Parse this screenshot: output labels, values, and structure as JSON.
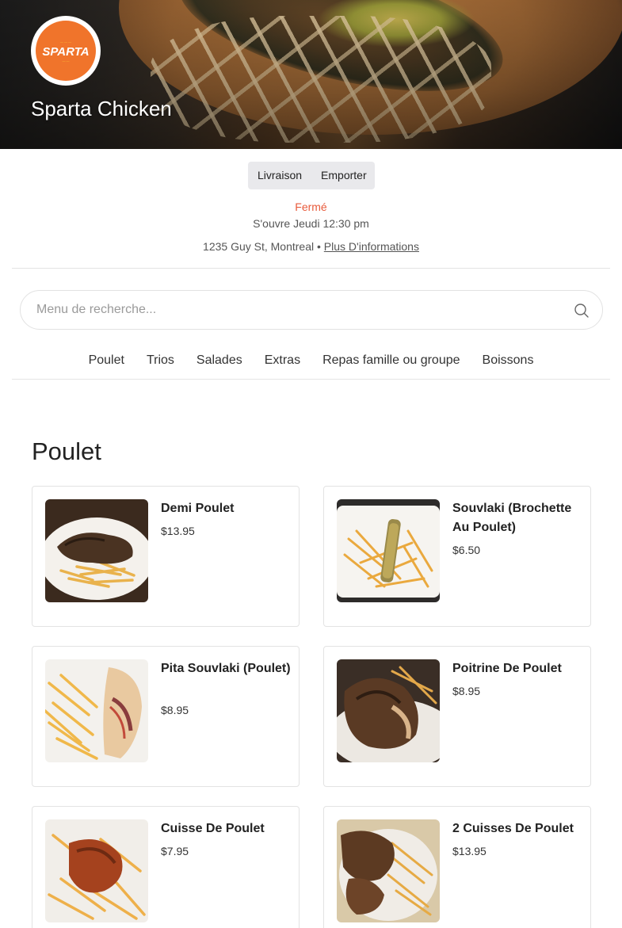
{
  "store": {
    "name": "Sparta Chicken",
    "logo_text": "SPARTA"
  },
  "order_modes": [
    "Livraison",
    "Emporter"
  ],
  "status": {
    "closed": "Fermé",
    "opens": "S'ouvre Jeudi 12:30 pm"
  },
  "location": {
    "address": "1235 Guy St, Montreal",
    "separator": " • ",
    "more_info": "Plus D'informations"
  },
  "search": {
    "placeholder": "Menu de recherche..."
  },
  "categories": [
    "Poulet",
    "Trios",
    "Salades",
    "Extras",
    "Repas famille ou groupe",
    "Boissons"
  ],
  "section": {
    "title": "Poulet",
    "items": [
      {
        "name": "Demi Poulet",
        "price": "$13.95"
      },
      {
        "name": "Souvlaki (Brochette Au Poulet)",
        "price": "$6.50"
      },
      {
        "name": "Pita Souvlaki (Poulet)",
        "price": "$8.95"
      },
      {
        "name": "Poitrine De Poulet",
        "price": "$8.95"
      },
      {
        "name": "Cuisse De Poulet",
        "price": "$7.95"
      },
      {
        "name": "2 Cuisses De Poulet",
        "price": "$13.95"
      }
    ]
  },
  "colors": {
    "accent": "#f0742b",
    "closed": "#e85b3c",
    "toggle_bg": "#e9e9ec"
  },
  "icons": {
    "search": "search-icon"
  }
}
